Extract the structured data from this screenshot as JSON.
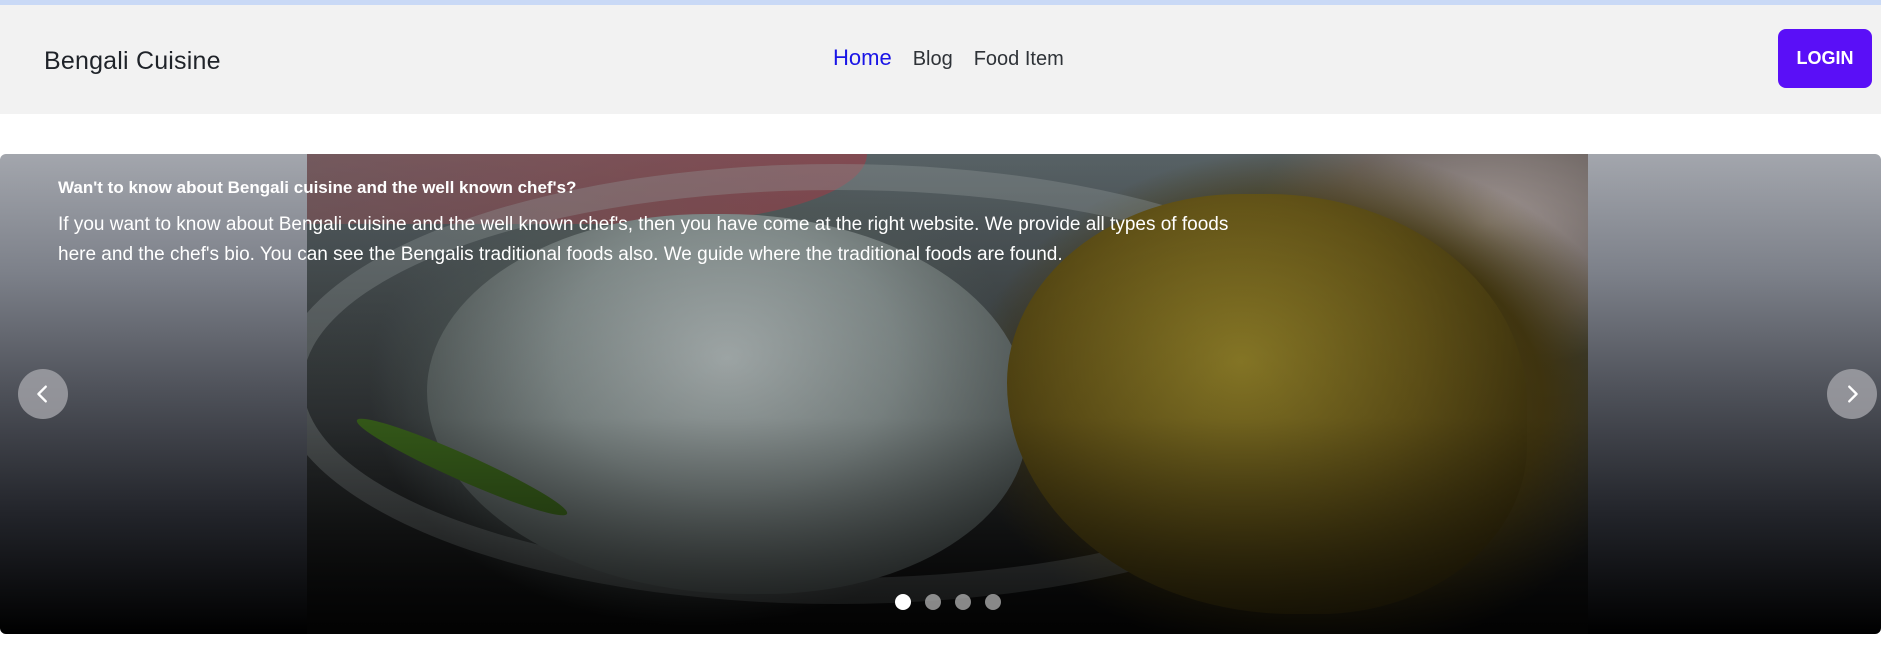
{
  "navbar": {
    "brand": "Bengali Cuisine",
    "links": [
      {
        "label": "Home",
        "active": true
      },
      {
        "label": "Blog",
        "active": false
      },
      {
        "label": "Food Item",
        "active": false
      }
    ],
    "login_label": "LOGIN",
    "colors": {
      "background": "#f2f2f2",
      "active_link": "#1a15e6",
      "login_button": "#5a0ff7"
    }
  },
  "carousel": {
    "slide": {
      "title": "Wan't to know about Bengali cuisine and the well known chef's?",
      "text": "If you want to know about Bengali cuisine and the well known chef's, then you have come at the right website. We provide all types of foods here and the chef's bio. You can see the Bengalis traditional foods also. We guide where the traditional foods are found.",
      "image": "rice-and-curry-photo"
    },
    "prev_icon": "chevron-left-icon",
    "next_icon": "chevron-right-icon",
    "indicators": {
      "count": 4,
      "active_index": 0
    }
  }
}
